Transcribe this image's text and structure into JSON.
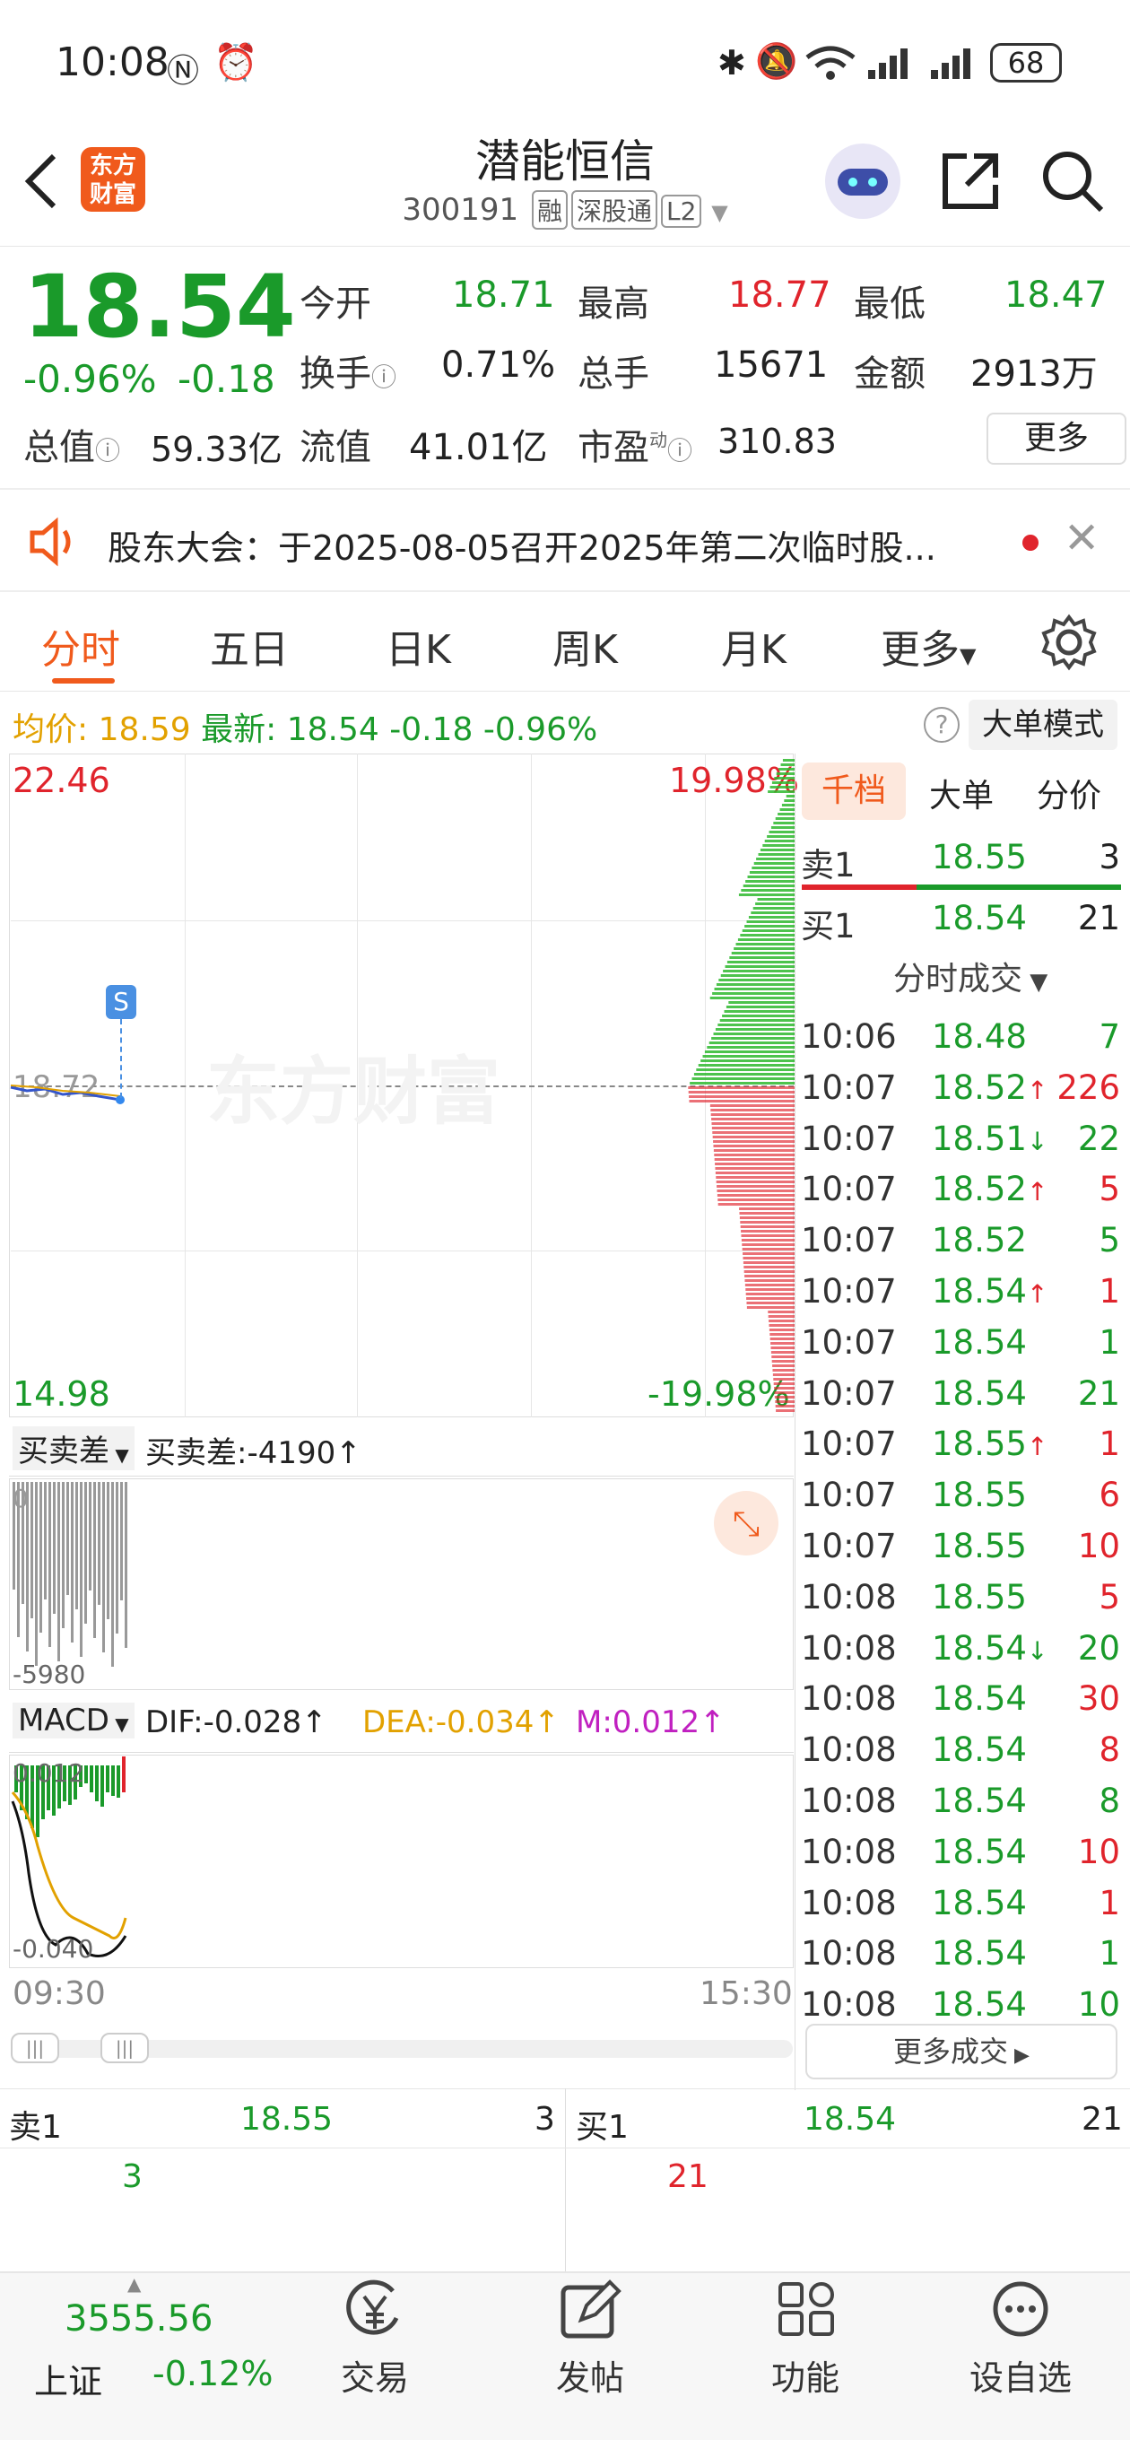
{
  "status_bar": {
    "time": "10:08",
    "battery": "68"
  },
  "header": {
    "title": "潜能恒信",
    "code": "300191",
    "tags": [
      "融",
      "深股通",
      "L2"
    ]
  },
  "logo": {
    "line1": "东方",
    "line2": "财富"
  },
  "quote": {
    "price": "18.54",
    "change_pct": "-0.96%",
    "change": "-0.18",
    "open_label": "今开",
    "open": "18.71",
    "high_label": "最高",
    "high": "18.77",
    "low_label": "最低",
    "low": "18.47",
    "turnover_label": "换手",
    "turnover": "0.71%",
    "volume_label": "总手",
    "volume": "15671",
    "amount_label": "金额",
    "amount": "2913万",
    "mktcap_label": "总值",
    "mktcap": "59.33亿",
    "float_label": "流值",
    "float": "41.01亿",
    "pe_label": "市盈",
    "pe_sup": "动",
    "pe": "310.83",
    "more": "更多"
  },
  "notice": {
    "text": "股东大会：于2025-08-05召开2025年第二次临时股..."
  },
  "tabs": [
    "分时",
    "五日",
    "日K",
    "周K",
    "月K",
    "更多"
  ],
  "infobar": {
    "avg_label": "均价:",
    "avg": "18.59",
    "latest_label": "最新:",
    "latest": "18.54",
    "chg": "-0.18",
    "pct": "-0.96%",
    "mode_btn": "大单模式"
  },
  "chart": {
    "y_max": "22.46",
    "y_max_pct": "19.98%",
    "y_min": "14.98",
    "y_min_pct": "-19.98%",
    "prev_close": "18.72",
    "watermark": "东方财富",
    "marker": "S",
    "time_start": "09:30",
    "time_end": "15:30"
  },
  "spread": {
    "selector": "买卖差",
    "label": "买卖差:-4190↑",
    "axis_top": "0",
    "axis_bottom": "-5980"
  },
  "macd": {
    "selector": "MACD",
    "dif": "DIF:-0.028↑",
    "dea": "DEA:-0.034↑",
    "m": "M:0.012↑",
    "axis_top": "0.012",
    "axis_bottom": "-0.040"
  },
  "side_tabs": [
    "千档",
    "大单",
    "分价"
  ],
  "order_book": {
    "sell1_label": "卖1",
    "sell1_price": "18.55",
    "sell1_vol": "3",
    "buy1_label": "买1",
    "buy1_price": "18.54",
    "buy1_vol": "21"
  },
  "trades_header": "分时成交",
  "trades": [
    {
      "t": "10:06",
      "p": "18.48",
      "a": "",
      "v": "7",
      "c": "dn"
    },
    {
      "t": "10:07",
      "p": "18.52",
      "a": "↑",
      "v": "226",
      "c": "up"
    },
    {
      "t": "10:07",
      "p": "18.51",
      "a": "↓",
      "v": "22",
      "c": "dn"
    },
    {
      "t": "10:07",
      "p": "18.52",
      "a": "↑",
      "v": "5",
      "c": "up"
    },
    {
      "t": "10:07",
      "p": "18.52",
      "a": "",
      "v": "5",
      "c": "dn"
    },
    {
      "t": "10:07",
      "p": "18.54",
      "a": "↑",
      "v": "1",
      "c": "up"
    },
    {
      "t": "10:07",
      "p": "18.54",
      "a": "",
      "v": "1",
      "c": "dn"
    },
    {
      "t": "10:07",
      "p": "18.54",
      "a": "",
      "v": "21",
      "c": "dn"
    },
    {
      "t": "10:07",
      "p": "18.55",
      "a": "↑",
      "v": "1",
      "c": "up"
    },
    {
      "t": "10:07",
      "p": "18.55",
      "a": "",
      "v": "6",
      "c": "up"
    },
    {
      "t": "10:07",
      "p": "18.55",
      "a": "",
      "v": "10",
      "c": "up"
    },
    {
      "t": "10:08",
      "p": "18.55",
      "a": "",
      "v": "5",
      "c": "up"
    },
    {
      "t": "10:08",
      "p": "18.54",
      "a": "↓",
      "v": "20",
      "c": "dn"
    },
    {
      "t": "10:08",
      "p": "18.54",
      "a": "",
      "v": "30",
      "c": "up"
    },
    {
      "t": "10:08",
      "p": "18.54",
      "a": "",
      "v": "8",
      "c": "up"
    },
    {
      "t": "10:08",
      "p": "18.54",
      "a": "",
      "v": "8",
      "c": "dn"
    },
    {
      "t": "10:08",
      "p": "18.54",
      "a": "",
      "v": "10",
      "c": "up"
    },
    {
      "t": "10:08",
      "p": "18.54",
      "a": "",
      "v": "1",
      "c": "up"
    },
    {
      "t": "10:08",
      "p": "18.54",
      "a": "",
      "v": "1",
      "c": "dn"
    },
    {
      "t": "10:08",
      "p": "18.54",
      "a": "",
      "v": "10",
      "c": "dn"
    }
  ],
  "more_trades": "更多成交",
  "bottom_book": {
    "sell_label": "卖1",
    "sell_price": "18.55",
    "sell_vol": "3",
    "sell_sub": "3",
    "buy_label": "买1",
    "buy_price": "18.54",
    "buy_vol": "21",
    "buy_sub": "21"
  },
  "index": {
    "value": "3555.56",
    "name": "上证",
    "pct": "-0.12%"
  },
  "nav": [
    "交易",
    "发帖",
    "功能",
    "设自选"
  ]
}
